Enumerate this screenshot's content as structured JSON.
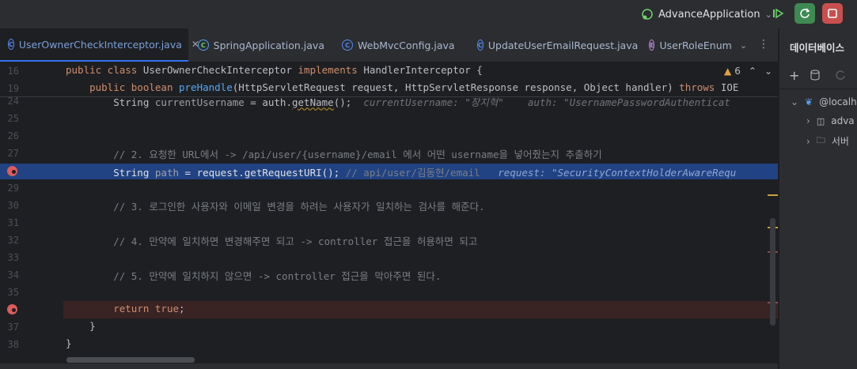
{
  "toolbar": {
    "run_config": "AdvanceApplication"
  },
  "tabs": [
    {
      "label": "UserOwnerCheckInterceptor.java",
      "icon": "C",
      "active": true
    },
    {
      "label": "SpringApplication.java",
      "icon": "C",
      "active": false
    },
    {
      "label": "WebMvcConfig.java",
      "icon": "C",
      "active": false
    },
    {
      "label": "UpdateUserEmailRequest.java",
      "icon": "C",
      "active": false
    },
    {
      "label": "UserRoleEnum",
      "icon": "E",
      "active": false
    }
  ],
  "db_panel": {
    "title": "데이터베이스",
    "tree": [
      "@localh",
      "adva",
      "서버"
    ]
  },
  "editor": {
    "warnings": "6",
    "sticky": [
      {
        "num": "16",
        "text": "public class UserOwnerCheckInterceptor implements HandlerInterceptor {"
      },
      {
        "num": "19",
        "text": "    public boolean preHandle(HttpServletRequest request, HttpServletResponse response, Object handler) throws IOE"
      }
    ],
    "lines": [
      {
        "num": "24",
        "code": "        String currentUsername = auth.getName();",
        "hint": "  currentUsername: \"장지혁\"    auth: \"UsernamePasswordAuthenticat"
      },
      {
        "num": "25",
        "code": "",
        "hint": ""
      },
      {
        "num": "26",
        "code": "",
        "hint": ""
      },
      {
        "num": "27",
        "code": "        // 2. 요청한 URL에서 -> /api/user/{username}/email 에서 어떤 username을 넣어줬는지 추출하기",
        "hint": ""
      },
      {
        "num": "",
        "code": "        String path = request.getRequestURI(); // api/user/김동현/email",
        "hint": "   request: \"SecurityContextHolderAwareRequ"
      },
      {
        "num": "29",
        "code": "",
        "hint": ""
      },
      {
        "num": "30",
        "code": "        // 3. 로그인한 사용자와 이메일 변경을 하려는 사용자가 일치하는 검사를 해준다.",
        "hint": ""
      },
      {
        "num": "31",
        "code": "",
        "hint": ""
      },
      {
        "num": "32",
        "code": "        // 4. 만약에 일치하면 변경해주면 되고 -> controller 접근을 허용하면 되고",
        "hint": ""
      },
      {
        "num": "33",
        "code": "",
        "hint": ""
      },
      {
        "num": "34",
        "code": "        // 5. 만약에 일치하지 않으면 -> controller 접근을 막아주면 된다.",
        "hint": ""
      },
      {
        "num": "35",
        "code": "",
        "hint": ""
      },
      {
        "num": "",
        "code": "        return true;",
        "hint": ""
      },
      {
        "num": "37",
        "code": "    }",
        "hint": ""
      },
      {
        "num": "38",
        "code": "}",
        "hint": ""
      }
    ]
  },
  "colors": {
    "accent": "#3574f0",
    "exec_line": "#214283",
    "breakpoint": "#db5c5c",
    "return_line": "#3a2323"
  }
}
